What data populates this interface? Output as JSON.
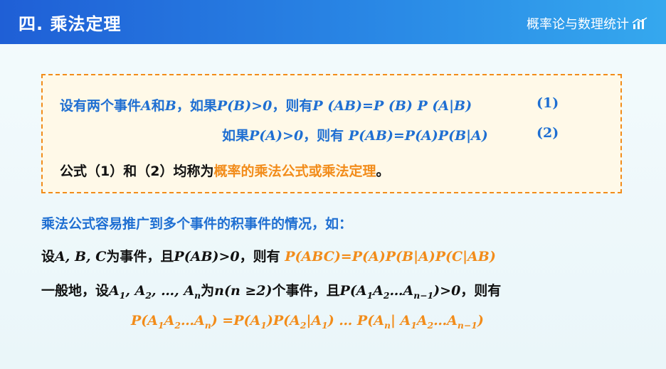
{
  "header": {
    "title": "四. 乘法定理",
    "brand": "概率论与数理统计"
  },
  "box": {
    "row1_prefix": "设有两个事件",
    "row1_A": "A",
    "row1_and": "和",
    "row1_B": "B",
    "row1_if": "，如果",
    "row1_cond": "P(B)>0",
    "row1_then": "，则有",
    "row1_formula": "P (AB)=P (B) P (A|B)",
    "row1_eqno": "(1)",
    "row2_if": "如果",
    "row2_cond": "P(A)>0",
    "row2_then": "，则有 ",
    "row2_formula": "P(AB)=P(A)P(B|A)",
    "row2_eqno": "(2)",
    "row3_prefix": "公式（1）和（2）均称为",
    "row3_highlight": "概率的乘法公式或乘法定理",
    "row3_suffix": "。"
  },
  "lead": "乘法公式容易推广到多个事件的积事件的情况，如：",
  "line1": {
    "prefix": "设",
    "events": "A, B, C",
    "mid": "为事件，且",
    "cond": "P(AB)>0",
    "then": "，则有 ",
    "formula": "P(ABC)=P(A)P(B|A)P(C|AB)"
  },
  "line2": {
    "prefix": "一般地，设",
    "mid": "为",
    "n_cond": "n(n ≥2)",
    "tail": "个事件，且",
    "then": "，则有"
  },
  "colors": {
    "accent_blue": "#1f6fd2",
    "accent_orange": "#f28c1a",
    "header": "#1f5fd6"
  },
  "icons": {
    "brand": "bar-chart-icon"
  }
}
